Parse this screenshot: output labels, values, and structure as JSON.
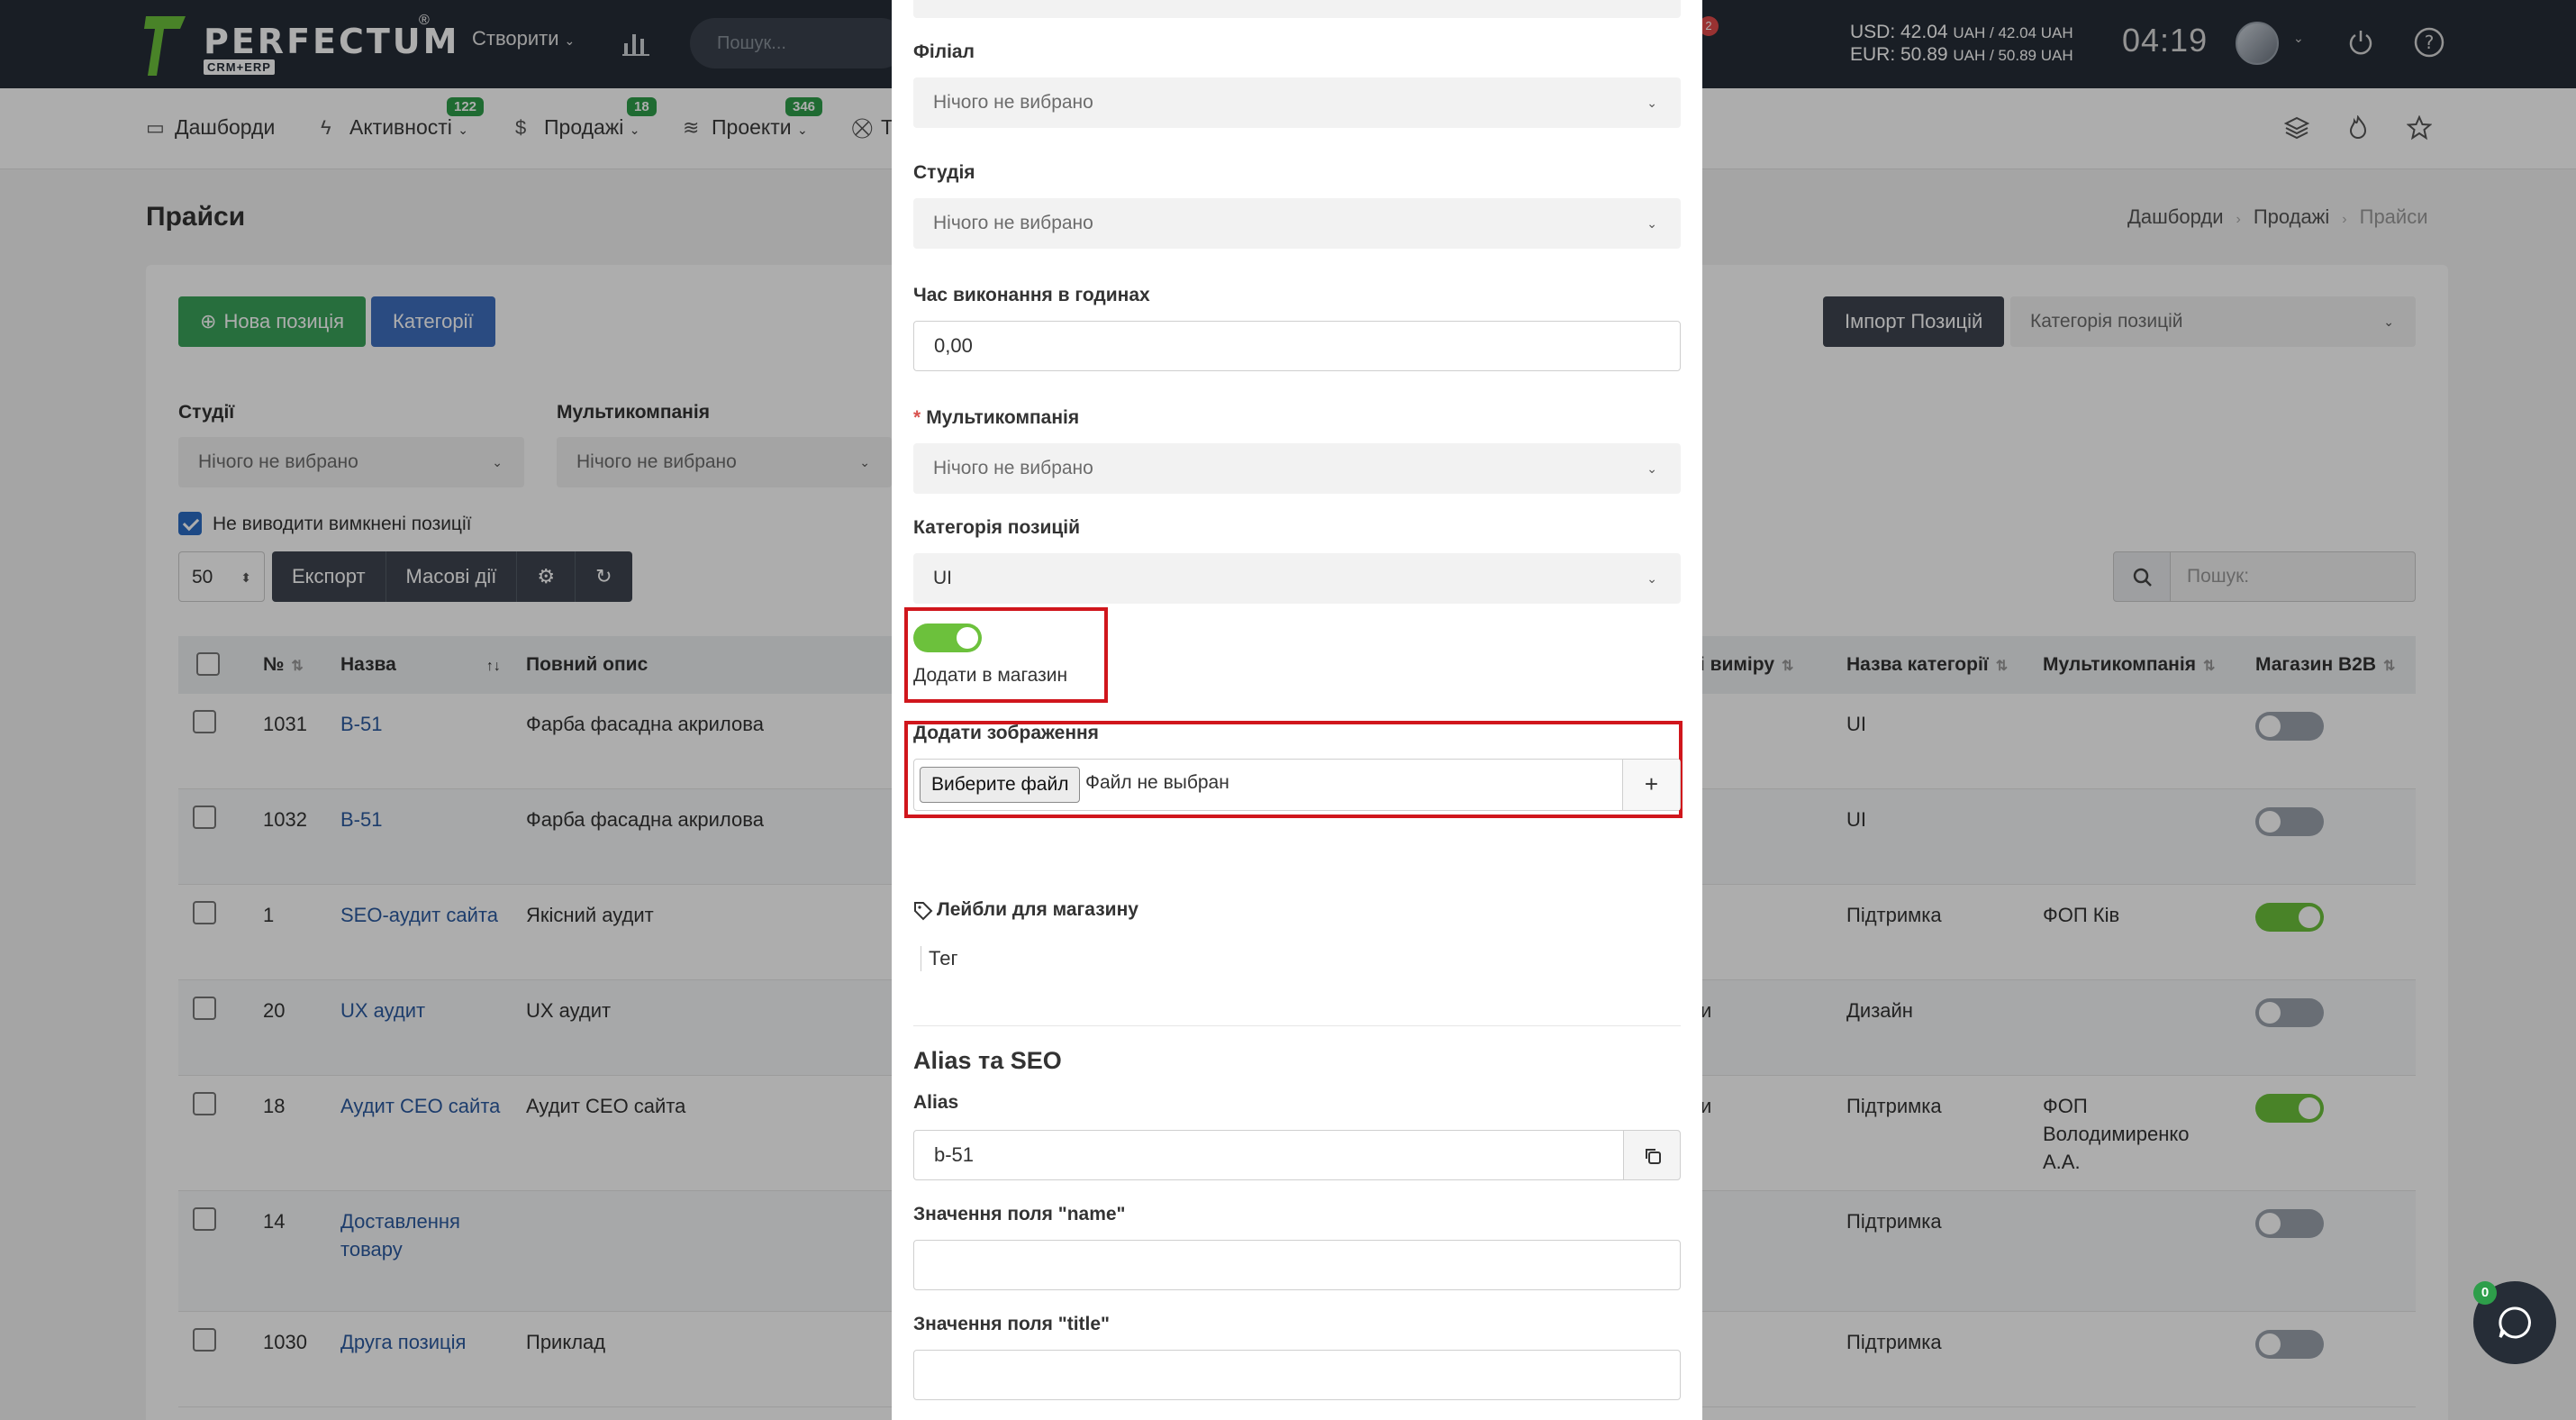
{
  "header": {
    "logo_text": "PERFECTUM",
    "logo_reg": "®",
    "logo_sub": "CRM+ERP",
    "create_label": "Створити",
    "search_placeholder": "Пошук...",
    "notif_count": "2",
    "currency_usd": "USD: 42.04",
    "currency_usd_rest": "UAH / 42.04 UAH",
    "currency_eur": "EUR: 50.89",
    "currency_eur_rest": "UAH / 50.89 UAH",
    "time": "04:19"
  },
  "nav": {
    "items": [
      {
        "label": "Дашборди",
        "icon": "monitor-icon"
      },
      {
        "label": "Активності",
        "icon": "bolt-icon",
        "badge": "122"
      },
      {
        "label": "Продажі",
        "icon": "dollar-icon",
        "badge": "18"
      },
      {
        "label": "Проекти",
        "icon": "layers-icon",
        "badge": "346"
      },
      {
        "label": "Т",
        "icon": "cart-icon"
      }
    ]
  },
  "page": {
    "title": "Прайси",
    "breadcrumbs": [
      "Дашборди",
      "Продажі",
      "Прайси"
    ]
  },
  "toolbar": {
    "new_position": "Нова позиція",
    "categories": "Категорії",
    "import": "Імпорт Позицій",
    "category_select": "Категорія позицій",
    "studios_label": "Студії",
    "studios_value": "Нічого не вибрано",
    "multicompany_label": "Мультикомпанія",
    "multicompany_value": "Нічого не вибрано",
    "hide_disabled": "Не виводити вимкнені позиції",
    "page_size": "50",
    "export": "Експорт",
    "bulk": "Масові дії",
    "search_placeholder": "Пошук:"
  },
  "table": {
    "columns": {
      "no": "№",
      "name": "Назва",
      "full": "Повний опис",
      "unit": "ці виміру",
      "category": "Назва категорії",
      "multi": "Мультикомпанія",
      "b2b": "Магазин B2B"
    },
    "rows": [
      {
        "no": "1031",
        "name": "B-51",
        "full": "Фарба фасадна акрилова",
        "unit": "",
        "category": "UI",
        "multi": "",
        "b2b": false
      },
      {
        "no": "1032",
        "name": "B-51",
        "full": "Фарба фасадна акрилова",
        "unit": "",
        "category": "UI",
        "multi": "",
        "b2b": false
      },
      {
        "no": "1",
        "name": "SEO-аудит сайта",
        "full": "Якісний аудит",
        "unit": "",
        "category": "Підтримка",
        "multi": "ФОП Ків",
        "b2b": true
      },
      {
        "no": "20",
        "name": "UX аудит",
        "full": "UX аудит",
        "unit": "и",
        "category": "Дизайн",
        "multi": "",
        "b2b": false
      },
      {
        "no": "18",
        "name": "Аудит СЕО сайта",
        "full": "Аудит СЕО сайта",
        "unit": "и",
        "category": "Підтримка",
        "multi": "ФОП Володимиренко А.А.",
        "b2b": true
      },
      {
        "no": "14",
        "name": "Доставлення товару",
        "full": "",
        "unit": "",
        "category": "Підтримка",
        "multi": "",
        "b2b": false
      },
      {
        "no": "1030",
        "name": "Друга позиція",
        "full": "Приклад",
        "unit": "",
        "category": "Підтримка",
        "multi": "",
        "b2b": false
      }
    ]
  },
  "modal": {
    "branch_label": "Філіал",
    "branch_value": "Нічого не вибрано",
    "studio_label": "Студія",
    "studio_value": "Нічого не вибрано",
    "hours_label": "Час виконання в годинах",
    "hours_value": "0,00",
    "multi_label": "Мультикомпанія",
    "multi_req": "*",
    "multi_value": "Нічого не вибрано",
    "cat_label": "Категорія позицій",
    "cat_value": "UI",
    "add_to_shop": "Додати в магазин",
    "add_image": "Додати зображення",
    "choose_file": "Виберите файл",
    "no_file": "Файл не выбран",
    "plus": "+",
    "labels_title": "Лейбли для магазину",
    "tag_placeholder": "Тег",
    "seo_title": "Alias та SEO",
    "alias_label": "Alias",
    "alias_value": "b-51",
    "name_label": "Значення поля \"name\"",
    "title_label": "Значення поля \"title\""
  },
  "chat": {
    "badge": "0"
  },
  "colors": {
    "accent_green": "#3aa35a",
    "accent_blue": "#3f6fbf",
    "highlight_red": "#d0161c",
    "header_bg": "#262d37"
  }
}
